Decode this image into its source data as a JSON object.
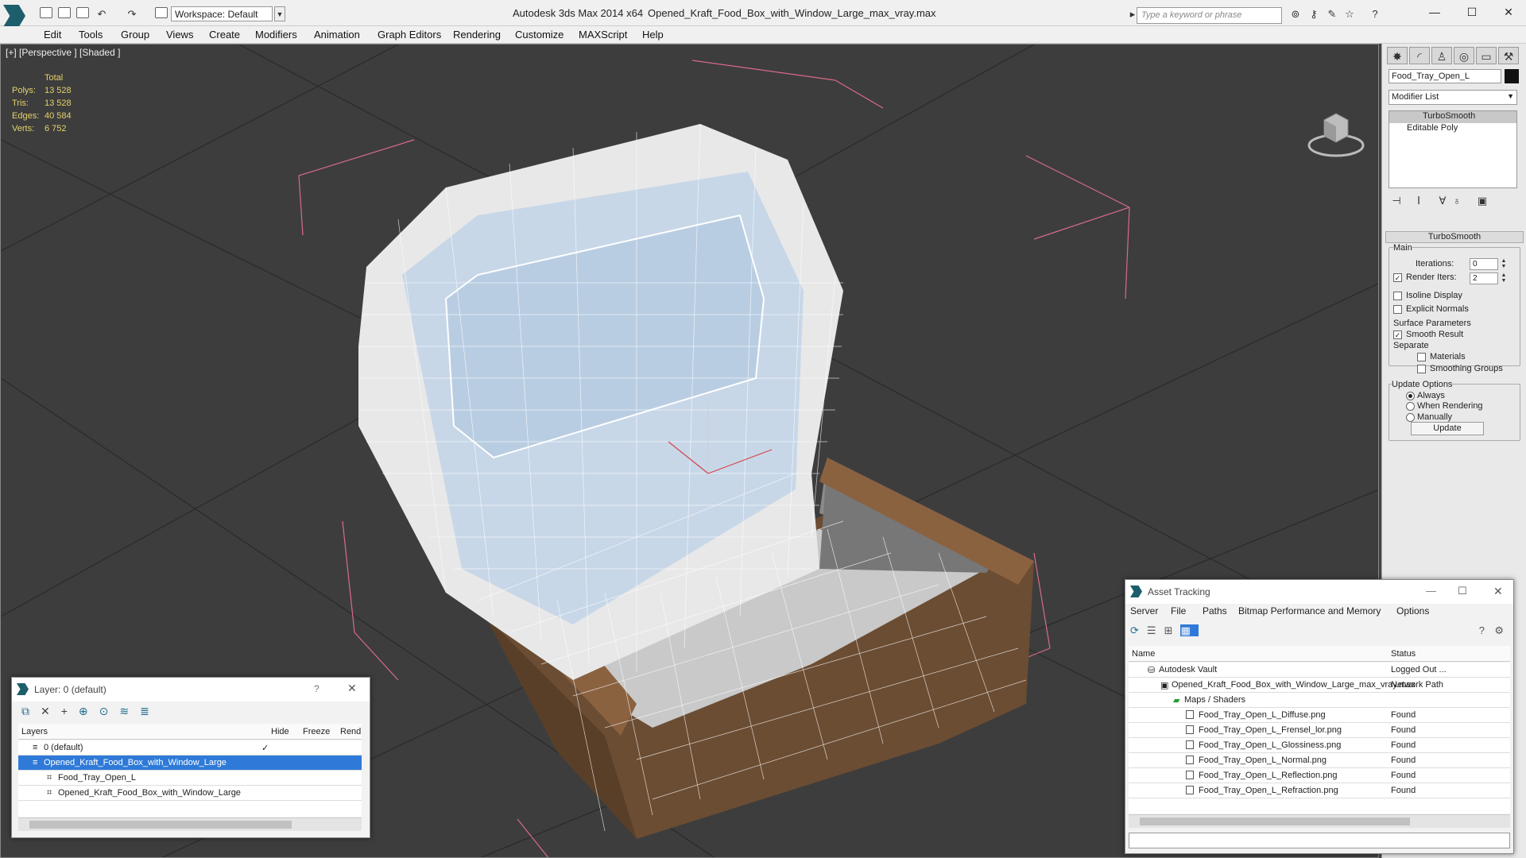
{
  "title_bar": {
    "workspace_label": "Workspace: Default",
    "app_title": "Autodesk 3ds Max  2014 x64",
    "file_title": "Opened_Kraft_Food_Box_with_Window_Large_max_vray.max",
    "search_placeholder": "Type a keyword or phrase"
  },
  "menu": [
    "Edit",
    "Tools",
    "Group",
    "Views",
    "Create",
    "Modifiers",
    "Animation",
    "Graph Editors",
    "Rendering",
    "Customize",
    "MAXScript",
    "Help"
  ],
  "viewport": {
    "label": "[+] [Perspective ] [Shaded ]",
    "stats": {
      "header": "Total",
      "polys_label": "Polys:",
      "polys": "13 528",
      "tris_label": "Tris:",
      "tris": "13 528",
      "edges_label": "Edges:",
      "edges": "40 584",
      "verts_label": "Verts:",
      "verts": "6 752"
    }
  },
  "command_panel": {
    "object_name": "Food_Tray_Open_L",
    "modifier_list": "Modifier List",
    "stack": [
      "TurboSmooth",
      "Editable Poly"
    ],
    "rollout_title": "TurboSmooth",
    "main_label": "Main",
    "iterations_label": "Iterations:",
    "iterations": "0",
    "render_iters_label": "Render Iters:",
    "render_iters": "2",
    "isoline_label": "Isoline Display",
    "explicit_normals_label": "Explicit Normals",
    "surface_params_label": "Surface Parameters",
    "smooth_result_label": "Smooth Result",
    "separate_label": "Separate",
    "materials_label": "Materials",
    "smoothing_groups_label": "Smoothing Groups",
    "update_options_label": "Update Options",
    "always_label": "Always",
    "when_rendering_label": "When Rendering",
    "manually_label": "Manually",
    "update_button": "Update"
  },
  "layer_panel": {
    "title": "Layer: 0 (default)",
    "help": "?",
    "columns": [
      "Layers",
      "Hide",
      "Freeze",
      "Rend"
    ],
    "rows": [
      "0 (default)",
      "Opened_Kraft_Food_Box_with_Window_Large",
      "Food_Tray_Open_L",
      "Opened_Kraft_Food_Box_with_Window_Large"
    ]
  },
  "asset_panel": {
    "title": "Asset Tracking",
    "menu": [
      "Server",
      "File",
      "Paths",
      "Bitmap Performance and Memory",
      "Options"
    ],
    "columns": [
      "Name",
      "Status"
    ],
    "rows": [
      {
        "name": "Autodesk Vault",
        "status": "Logged Out ..."
      },
      {
        "name": "Opened_Kraft_Food_Box_with_Window_Large_max_vray.max",
        "status": "Network Path"
      },
      {
        "name": "Maps / Shaders",
        "status": ""
      },
      {
        "name": "Food_Tray_Open_L_Diffuse.png",
        "status": "Found"
      },
      {
        "name": "Food_Tray_Open_L_Frensel_lor.png",
        "status": "Found"
      },
      {
        "name": "Food_Tray_Open_L_Glossiness.png",
        "status": "Found"
      },
      {
        "name": "Food_Tray_Open_L_Normal.png",
        "status": "Found"
      },
      {
        "name": "Food_Tray_Open_L_Reflection.png",
        "status": "Found"
      },
      {
        "name": "Food_Tray_Open_L_Refraction.png",
        "status": "Found"
      }
    ]
  }
}
